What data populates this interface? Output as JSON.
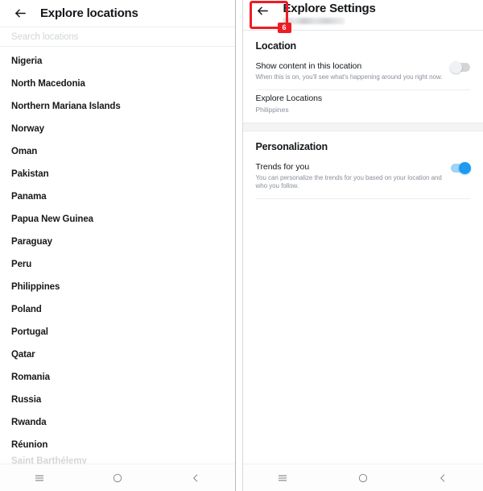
{
  "left_screen": {
    "appbar": {
      "back_icon": "arrow-left-icon",
      "title": "Explore locations"
    },
    "search": {
      "placeholder": "Search locations",
      "value": ""
    },
    "locations": [
      "Nigeria",
      "North Macedonia",
      "Northern Mariana Islands",
      "Norway",
      "Oman",
      "Pakistan",
      "Panama",
      "Papua New Guinea",
      "Paraguay",
      "Peru",
      "Philippines",
      "Poland",
      "Portugal",
      "Qatar",
      "Romania",
      "Russia",
      "Rwanda",
      "Réunion"
    ],
    "partial_item": "Saint Barthélemy",
    "navbar": {
      "recents": "recents-icon",
      "home": "home-icon",
      "back": "back-chevron-icon"
    }
  },
  "right_screen": {
    "appbar": {
      "back_icon": "arrow-left-icon",
      "title": "Explore Settings",
      "subtitle_redacted": ""
    },
    "annotation": {
      "badge_label": "6",
      "color": "#ee1c25",
      "target": "back-button"
    },
    "sections": [
      {
        "heading": "Location",
        "rows": [
          {
            "title": "Show content in this location",
            "subtitle": "When this is on, you'll see what's happening around you right now.",
            "control": "toggle",
            "toggle_state": "off"
          },
          {
            "title": "Explore Locations",
            "value": "Philippines",
            "control": "none"
          }
        ]
      },
      {
        "heading": "Personalization",
        "rows": [
          {
            "title": "Trends for you",
            "subtitle": "You can personalize the trends for you based on your location and who you follow.",
            "control": "toggle",
            "toggle_state": "on"
          }
        ]
      }
    ],
    "navbar": {
      "recents": "recents-icon",
      "home": "home-icon",
      "back": "back-chevron-icon"
    }
  },
  "colors": {
    "accent_on": "#1d9bf0",
    "toggle_off": "#d3d6d9",
    "annotation_red": "#ee1c25",
    "text_primary": "#14171a",
    "text_secondary": "#8a9099"
  }
}
